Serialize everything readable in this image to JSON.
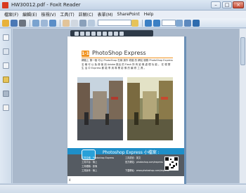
{
  "window": {
    "title": "HW30012.pdf - Foxit Reader"
  },
  "menu": {
    "items": [
      "檔案(F)",
      "編輯(E)",
      "檢視(V)",
      "工具(T)",
      "註解(C)",
      "表單(M)",
      "SharePoint",
      "Help"
    ]
  },
  "toolbar": {
    "zoom_value": ""
  },
  "document": {
    "section_number": "1-1",
    "section_title": "PhotoShop Express",
    "paragraph": "網路上 第一個 可以 PhotoShop 在線 操作 修圖 的 網站 服務 PhotoShop Express 名 稱 可 以 免 費 使 用 Adobe 推出 的 Flash 所 有 影 像 處 理 功 能 。 在 現 實 生 活 中 Express 都 能 享 用 專 業 影 像 的 編 修 工 具 。",
    "banner": {
      "title": "Photoshop Express 小檔案 :",
      "left_lines": [
        "工具名稱：Photoshop Express",
        "工具平台：線上",
        "工具種類：影像",
        "工具版本：線上"
      ],
      "right_lines": [
        "工具語言：英文",
        "官方網站：photoshop.com/express",
        "",
        "下載網址：www.photoshop.com/express"
      ]
    },
    "page_number": "4"
  },
  "colors": {
    "accent_orange": "#f09320",
    "banner_blue": "#1e8fc9",
    "banner_gray": "#555b62"
  }
}
